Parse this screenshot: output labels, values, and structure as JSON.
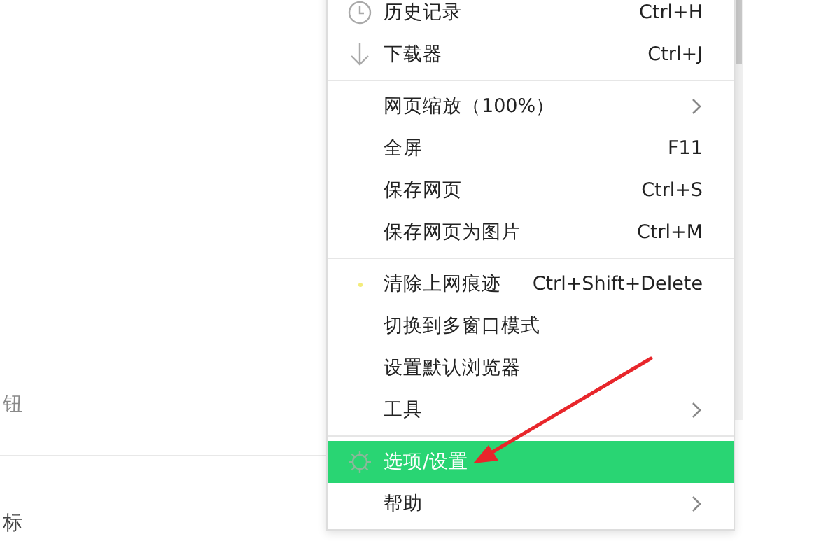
{
  "background_texts": [
    {
      "text": "钮"
    },
    {
      "text": "标"
    }
  ],
  "menu": {
    "groups": [
      {
        "items": [
          {
            "kind": "clock",
            "label": "历史记录",
            "shortcut": "Ctrl+H",
            "submenu": false,
            "selected": false
          },
          {
            "kind": "download",
            "label": "下载器",
            "shortcut": "Ctrl+J",
            "submenu": false,
            "selected": false
          }
        ]
      },
      {
        "items": [
          {
            "kind": "plain",
            "label": "网页缩放（100%）",
            "submenu": true,
            "selected": false
          },
          {
            "kind": "plain",
            "label": "全屏",
            "shortcut": "F11",
            "submenu": false,
            "selected": false
          },
          {
            "kind": "plain",
            "label": "保存网页",
            "shortcut": "Ctrl+S",
            "submenu": false,
            "selected": false
          },
          {
            "kind": "plain",
            "label": "保存网页为图片",
            "shortcut": "Ctrl+M",
            "submenu": false,
            "selected": false
          }
        ]
      },
      {
        "items": [
          {
            "kind": "dot",
            "label": "清除上网痕迹",
            "shortcut": "Ctrl+Shift+Delete",
            "submenu": false,
            "selected": false
          },
          {
            "kind": "plain",
            "label": "切换到多窗口模式",
            "submenu": false,
            "selected": false
          },
          {
            "kind": "plain",
            "label": "设置默认浏览器",
            "submenu": false,
            "selected": false
          },
          {
            "kind": "plain",
            "label": "工具",
            "submenu": true,
            "selected": false
          }
        ]
      },
      {
        "items": [
          {
            "kind": "gear",
            "label": "选项/设置",
            "submenu": false,
            "selected": true
          },
          {
            "kind": "plain",
            "label": "帮助",
            "submenu": true,
            "selected": false
          }
        ]
      }
    ]
  }
}
